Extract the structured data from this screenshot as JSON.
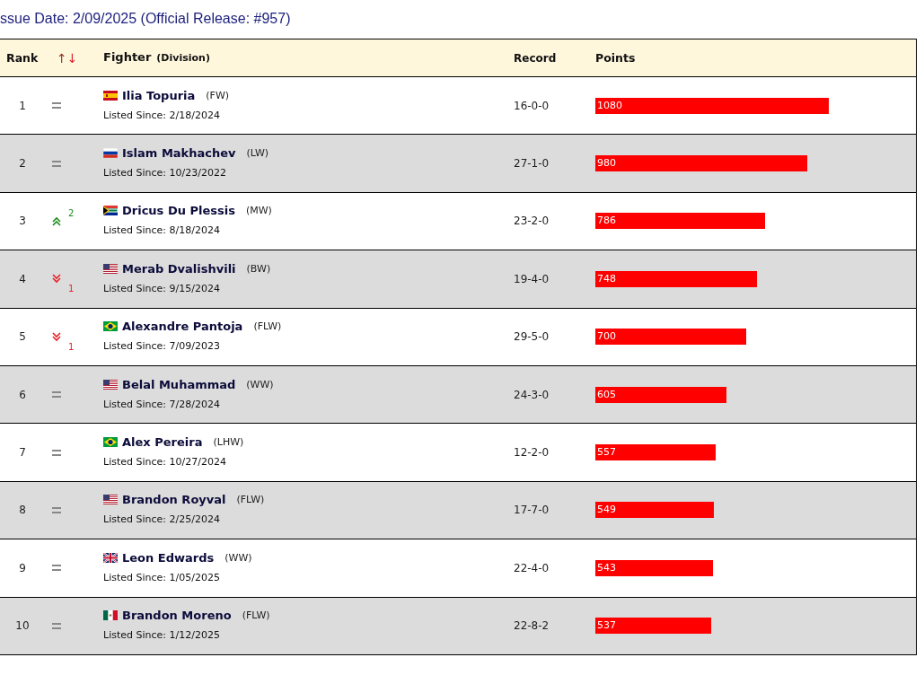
{
  "heading": "ssue Date: 2/09/2025 (Official Release: #957)",
  "table": {
    "columns": {
      "rank": "Rank",
      "move_up": "↑",
      "move_down": "↓",
      "fighter": "Fighter",
      "division": "(Division)",
      "record": "Record",
      "points": "Points"
    },
    "rows": [
      {
        "rank": "1",
        "movement": {
          "kind": "same"
        },
        "name": "Ilia Topuria",
        "flag_icon": {
          "kind": "es"
        },
        "division": "(FW)",
        "listed": "Listed Since: 2/18/2024",
        "record": "16-0-0",
        "points": "1080"
      },
      {
        "rank": "2",
        "movement": {
          "kind": "same"
        },
        "name": "Islam Makhachev",
        "flag_icon": {
          "kind": "ru"
        },
        "division": "(LW)",
        "listed": "Listed Since: 10/23/2022",
        "record": "27-1-0",
        "points": "980"
      },
      {
        "rank": "3",
        "movement": {
          "kind": "up",
          "change": "2"
        },
        "name": "Dricus Du Plessis",
        "flag_icon": {
          "kind": "za"
        },
        "division": "(MW)",
        "listed": "Listed Since: 8/18/2024",
        "record": "23-2-0",
        "points": "786"
      },
      {
        "rank": "4",
        "movement": {
          "kind": "down",
          "change": "1"
        },
        "name": "Merab Dvalishvili",
        "flag_icon": {
          "kind": "us"
        },
        "division": "(BW)",
        "listed": "Listed Since: 9/15/2024",
        "record": "19-4-0",
        "points": "748"
      },
      {
        "rank": "5",
        "movement": {
          "kind": "down",
          "change": "1"
        },
        "name": "Alexandre Pantoja",
        "flag_icon": {
          "kind": "br"
        },
        "division": "(FLW)",
        "listed": "Listed Since: 7/09/2023",
        "record": "29-5-0",
        "points": "700"
      },
      {
        "rank": "6",
        "movement": {
          "kind": "same"
        },
        "name": "Belal Muhammad",
        "flag_icon": {
          "kind": "us"
        },
        "division": "(WW)",
        "listed": "Listed Since: 7/28/2024",
        "record": "24-3-0",
        "points": "605"
      },
      {
        "rank": "7",
        "movement": {
          "kind": "same"
        },
        "name": "Alex Pereira",
        "flag_icon": {
          "kind": "br"
        },
        "division": "(LHW)",
        "listed": "Listed Since: 10/27/2024",
        "record": "12-2-0",
        "points": "557"
      },
      {
        "rank": "8",
        "movement": {
          "kind": "same"
        },
        "name": "Brandon Royval",
        "flag_icon": {
          "kind": "us"
        },
        "division": "(FLW)",
        "listed": "Listed Since: 2/25/2024",
        "record": "17-7-0",
        "points": "549"
      },
      {
        "rank": "9",
        "movement": {
          "kind": "same"
        },
        "name": "Leon Edwards",
        "flag_icon": {
          "kind": "gb"
        },
        "division": "(WW)",
        "listed": "Listed Since: 1/05/2025",
        "record": "22-4-0",
        "points": "543"
      },
      {
        "rank": "10",
        "movement": {
          "kind": "same"
        },
        "name": "Brandon Moreno",
        "flag_icon": {
          "kind": "mx"
        },
        "division": "(FLW)",
        "listed": "Listed Since: 1/12/2025",
        "record": "22-8-2",
        "points": "537"
      }
    ]
  }
}
